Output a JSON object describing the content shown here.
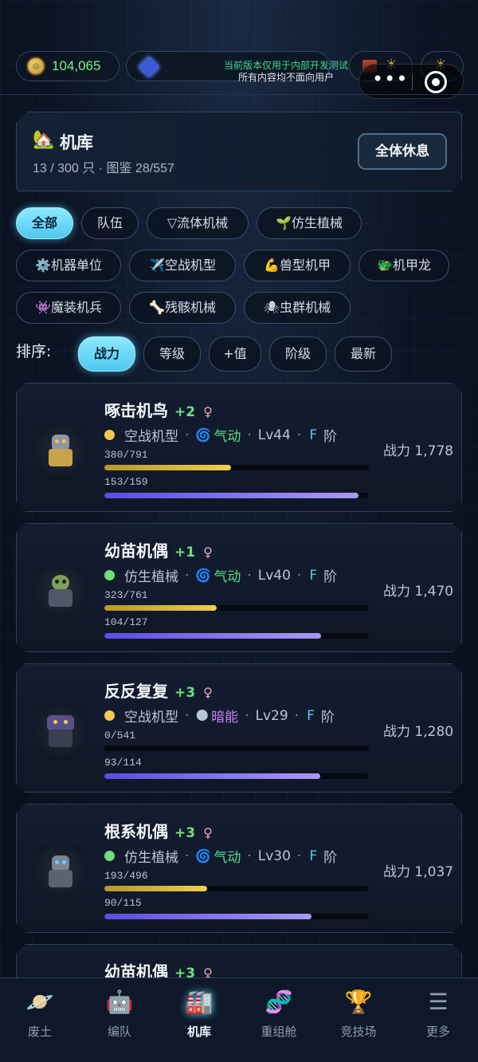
{
  "top_bar": {
    "coins": "104,065",
    "notice_line1": "当前版本仅用于内部开发测试",
    "notice_line2": "所有内容均不面向用户",
    "more_label": "•••"
  },
  "hangar": {
    "title": "机库",
    "subtitle": "13 / 300 只 · 图鉴 28/557",
    "rest_button": "全体休息"
  },
  "filters": [
    {
      "label": "全部"
    },
    {
      "label": "队伍"
    },
    {
      "label": "▽流体机械"
    },
    {
      "label": "🌱仿生植械"
    },
    {
      "label": "⚙️机器单位"
    },
    {
      "label": "✈️空战机型"
    },
    {
      "label": "💪兽型机甲"
    },
    {
      "label": "🐲机甲龙"
    },
    {
      "label": "👾魔装机兵"
    },
    {
      "label": "🦴残骸机械"
    },
    {
      "label": "🕷虫群机械"
    }
  ],
  "sort": {
    "label": "排序:",
    "options": [
      "战力",
      "等级",
      "+值",
      "阶级",
      "最新"
    ]
  },
  "units": [
    {
      "name": "啄击机鸟",
      "plus": "+2",
      "gender": "♀",
      "dot_color": "#f2c94c",
      "type": "空战机型",
      "element_icon": "🌀",
      "element": "气动",
      "level": "Lv44",
      "grade": "F",
      "grade_suffix": "阶",
      "exp_text": "380/791",
      "exp_ratio": 0.4804,
      "hp_text": "153/159",
      "hp_ratio": 0.9623,
      "power": "战力 1,778"
    },
    {
      "name": "幼苗机偶",
      "plus": "+1",
      "gender": "♀",
      "dot_color": "#6fe07c",
      "type": "仿生植械",
      "element_icon": "🌀",
      "element": "气动",
      "level": "Lv40",
      "grade": "F",
      "grade_suffix": "阶",
      "exp_text": "323/761",
      "exp_ratio": 0.4244,
      "hp_text": "104/127",
      "hp_ratio": 0.8189,
      "power": "战力 1,470"
    },
    {
      "name": "反反复复",
      "plus": "+3",
      "gender": "♀",
      "dot_color": "#f2c94c",
      "type": "空战机型",
      "element_icon": "🌑",
      "element": "暗能",
      "level": "Lv29",
      "grade": "F",
      "grade_suffix": "阶",
      "exp_text": "0/541",
      "exp_ratio": 0,
      "hp_text": "93/114",
      "hp_ratio": 0.8158,
      "power": "战力 1,280"
    },
    {
      "name": "根系机偶",
      "plus": "+3",
      "gender": "♀",
      "dot_color": "#6fe07c",
      "type": "仿生植械",
      "element_icon": "🌀",
      "element": "气动",
      "level": "Lv30",
      "grade": "F",
      "grade_suffix": "阶",
      "exp_text": "193/496",
      "exp_ratio": 0.3891,
      "hp_text": "90/115",
      "hp_ratio": 0.7826,
      "power": "战力 1,037"
    },
    {
      "name": "幼苗机偶",
      "plus": "+3",
      "gender": "♀"
    }
  ],
  "nav": [
    {
      "label": "废土",
      "icon": "planet-icon"
    },
    {
      "label": "编队",
      "icon": "robot-icon"
    },
    {
      "label": "机库",
      "icon": "factory-icon"
    },
    {
      "label": "重组舱",
      "icon": "dna-icon"
    },
    {
      "label": "竞技场",
      "icon": "trophy-icon"
    },
    {
      "label": "更多",
      "icon": "menu-icon"
    }
  ],
  "colors": {
    "accent": "#4ec8f0",
    "positive": "#6fe07c",
    "exp_bar": "#f2cf48",
    "hp_bar": "#8a7cf2",
    "grade": "#53c7f0"
  }
}
